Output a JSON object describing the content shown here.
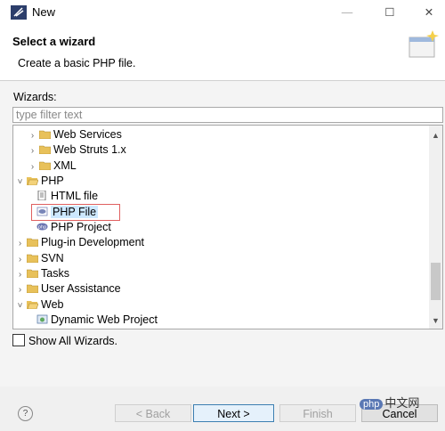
{
  "window": {
    "title": "New",
    "min_glyph": "—",
    "max_glyph": "☐",
    "close_glyph": "✕"
  },
  "header": {
    "title": "Select a wizard",
    "description": "Create a basic PHP file."
  },
  "wizards": {
    "label": "Wizards:",
    "filter_placeholder": "type filter text",
    "tree": [
      {
        "label": "Web Services",
        "twisty": ">",
        "kind": "folder"
      },
      {
        "label": "Web Struts 1.x",
        "twisty": ">",
        "kind": "folder"
      },
      {
        "label": "XML",
        "twisty": ">",
        "kind": "folder"
      },
      {
        "label": "PHP",
        "twisty": "v",
        "kind": "folder-open"
      },
      {
        "label": "HTML file",
        "twisty": "",
        "kind": "html-file"
      },
      {
        "label": "PHP File",
        "twisty": "",
        "kind": "php-file",
        "selected": true
      },
      {
        "label": "PHP Project",
        "twisty": "",
        "kind": "php-project"
      },
      {
        "label": "Plug-in Development",
        "twisty": ">",
        "kind": "folder"
      },
      {
        "label": "SVN",
        "twisty": ">",
        "kind": "folder"
      },
      {
        "label": "Tasks",
        "twisty": ">",
        "kind": "folder"
      },
      {
        "label": "User Assistance",
        "twisty": ">",
        "kind": "folder"
      },
      {
        "label": "Web",
        "twisty": "v",
        "kind": "folder-open"
      },
      {
        "label": "Dynamic Web Project",
        "twisty": "",
        "kind": "web-project"
      }
    ],
    "show_all_label": "Show All Wizards.",
    "show_all_checked": false
  },
  "buttons": {
    "help": "?",
    "back": "< Back",
    "next": "Next >",
    "finish": "Finish",
    "cancel": "Cancel"
  },
  "watermark": {
    "badge": "php",
    "text": "中文网"
  },
  "colors": {
    "selection": "#cde8ff",
    "highlight_border": "#e06060",
    "folder": "#e8c15a"
  }
}
